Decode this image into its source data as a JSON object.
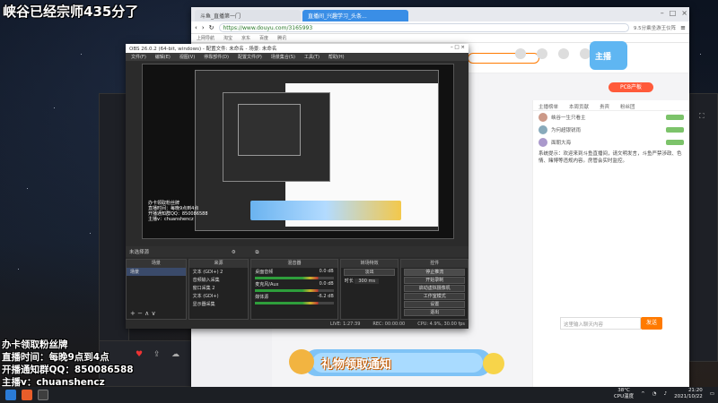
{
  "overlay": {
    "title": "峡谷已经宗师435分了",
    "bottom_lines": [
      "办卡领取粉丝牌",
      "直播时间：每晚9点到4点",
      "开播通知群QQ：850086588",
      "主播v：chuanshencz"
    ]
  },
  "browser": {
    "tabs": [
      "斗鱼_直播第一门",
      "直播间_兴趣学习_头条..."
    ],
    "url": "https://www.douyu.com/3165993",
    "bookmarks": [
      "上网导航",
      "淘宝",
      "京东",
      "百度",
      "腾讯"
    ],
    "search_hint": "9.5分乘坐游王仪阵",
    "pcb_label": "PCB产板",
    "chat": {
      "tabs": [
        "主播榜单",
        "本周贡献",
        "贵宾",
        "粉丝团"
      ],
      "ranks": [
        "峡谷一生只看主",
        "为何超银锐雨",
        "面朝大海"
      ],
      "notice": "系统提示：欢迎来到斗鱼直播间，请文明发言，斗鱼严禁涉政、色情、赌博等违规内容。房管会实时监控。",
      "input_placeholder": "这里输入聊天内容",
      "send_label": "发送"
    }
  },
  "obs": {
    "title": "OBS 26.0.2 (64-bit, windows) - 配置文件: 未命名 - 场景: 未命名",
    "menu": [
      "文件(F)",
      "编辑(E)",
      "视图(V)",
      "停靠部件(D)",
      "配置文件(P)",
      "场景集合(S)",
      "工具(T)",
      "帮助(H)"
    ],
    "scene_bar": "未选择源",
    "panels": {
      "scenes": "场景",
      "sources": "来源",
      "mixer": "混音器",
      "transitions": "转场特效",
      "controls": "控件"
    },
    "scene_items": [
      "场景"
    ],
    "source_items": [
      "文本 (GDI+) 2",
      "音频输入采集",
      "窗口采集 2",
      "文本 (GDI+)",
      "显示器采集"
    ],
    "mixer_items": [
      "桌面音频",
      "麦克风/Aux",
      "媒体源"
    ],
    "mixer_db": [
      "0.0 dB",
      "0.0 dB",
      "-6.2 dB"
    ],
    "transition_values": [
      "淡出",
      "时长",
      "300 ms"
    ],
    "control_buttons": [
      "停止推流",
      "开始录制",
      "启动虚拟摄像机",
      "工作室模式",
      "设置",
      "退出"
    ],
    "status": [
      "LIVE: 1:27:39",
      "REC: 00:00:00",
      "CPU: 4.9%, 30.00 fps"
    ]
  },
  "gift_banner": "礼物领取通知",
  "taskbar": {
    "weather": "38°C",
    "weather_sub": "CPU温度",
    "time": "21:20",
    "date": "2021/10/22"
  }
}
